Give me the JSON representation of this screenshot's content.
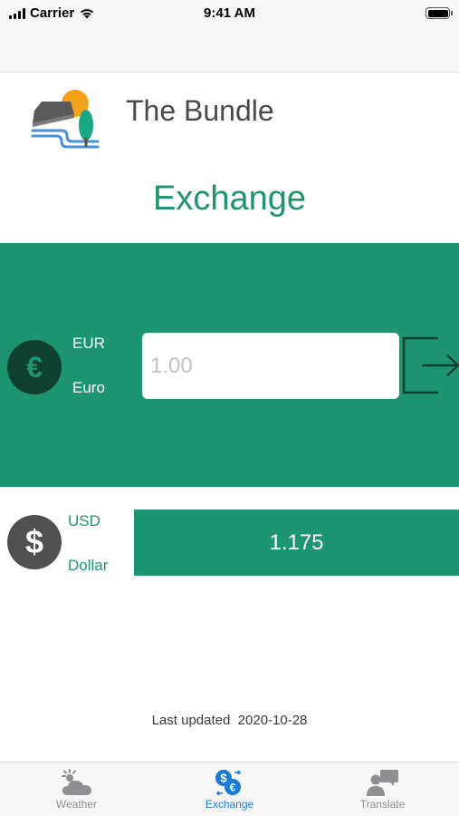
{
  "status_bar": {
    "carrier": "Carrier",
    "time": "9:41 AM"
  },
  "header": {
    "app_name": "The Bundle",
    "title": "Exchange"
  },
  "source": {
    "code": "EUR",
    "name": "Euro",
    "symbol": "€",
    "amount_placeholder": "1.00",
    "amount_value": ""
  },
  "target": {
    "code": "USD",
    "name": "Dollar",
    "symbol": "$",
    "result": "1.175"
  },
  "last_updated": {
    "label": "Last updated",
    "date": "2020-10-28"
  },
  "tabs": [
    {
      "label": "Weather",
      "icon": "weather-icon",
      "active": false
    },
    {
      "label": "Exchange",
      "icon": "exchange-icon",
      "active": true
    },
    {
      "label": "Translate",
      "icon": "translate-icon",
      "active": false
    }
  ],
  "colors": {
    "accent": "#1d9570",
    "tab_active": "#1a7bd6",
    "tab_inactive": "#8e8e93"
  }
}
